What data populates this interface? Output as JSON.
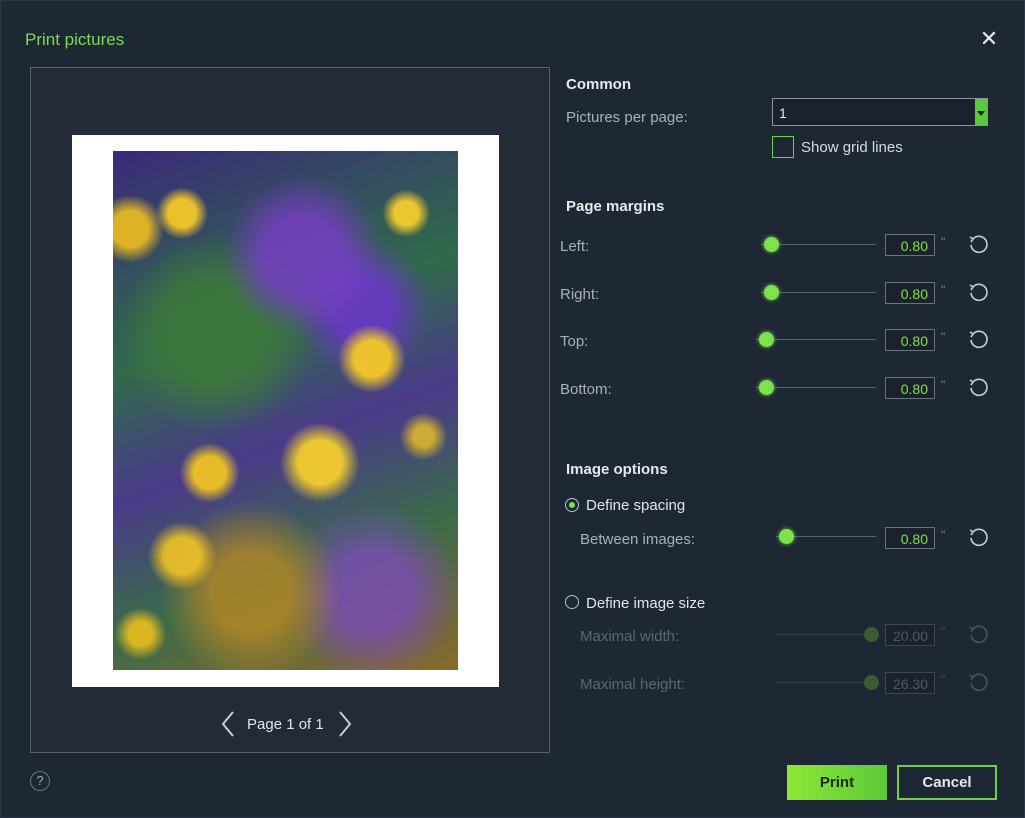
{
  "title": "Print pictures",
  "preview": {
    "page_label": "Page 1 of 1"
  },
  "common": {
    "heading": "Common",
    "pictures_per_page_label": "Pictures per page:",
    "pictures_per_page_value": "1",
    "show_grid_lines_label": "Show grid lines",
    "show_grid_lines_checked": false
  },
  "margins": {
    "heading": "Page margins",
    "unit": "\"",
    "items": [
      {
        "label": "Left:",
        "value": "0.80"
      },
      {
        "label": "Right:",
        "value": "0.80"
      },
      {
        "label": "Top:",
        "value": "0.80"
      },
      {
        "label": "Bottom:",
        "value": "0.80"
      }
    ]
  },
  "image_options": {
    "heading": "Image options",
    "define_spacing_label": "Define spacing",
    "between_images_label": "Between images:",
    "between_images_value": "0.80",
    "define_size_label": "Define image size",
    "max_width_label": "Maximal width:",
    "max_width_value": "20.00",
    "max_height_label": "Maximal height:",
    "max_height_value": "26.30",
    "selected": "define_spacing"
  },
  "buttons": {
    "print": "Print",
    "cancel": "Cancel",
    "help": "?"
  },
  "colors": {
    "accent": "#7ee24a",
    "background": "#1e2734",
    "title": "#7ed957"
  }
}
